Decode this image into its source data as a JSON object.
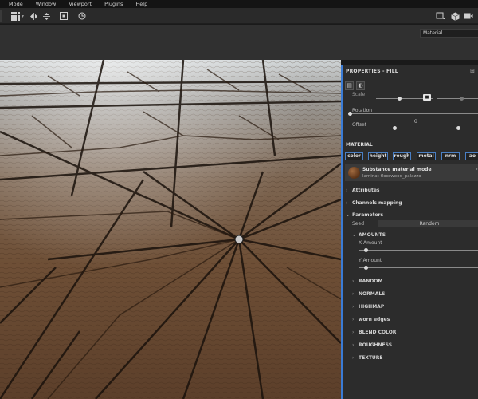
{
  "menu": [
    "Mode",
    "Window",
    "Viewport",
    "Plugins",
    "Help"
  ],
  "toolbar_icons": [
    "grid-icon",
    "flip-horizontal-icon",
    "flip-vertical-icon",
    "frame-icon",
    "reset-icon",
    "screen-icon",
    "cube-icon",
    "camera-icon"
  ],
  "viewport_select": "Material",
  "panel": {
    "title": "PROPERTIES - FILL",
    "menu_glyph": "⊞",
    "scale_label": "Scale",
    "rotation_label": "Rotation",
    "offset_label": "Offset",
    "offset_value": "0",
    "material_section": "MATERIAL",
    "channels": [
      "color",
      "height",
      "rough",
      "metal",
      "nrm",
      "ao"
    ],
    "material_mode": "Substance material mode",
    "material_name": "laminat-floorwood_palazzo",
    "attributes": "Attributes",
    "channels_mapping": "Channels mapping",
    "parameters": "Parameters",
    "seed_label": "Seed",
    "seed_value": "Random",
    "amounts": "AMOUNTS",
    "x_amount": "X Amount",
    "y_amount": "Y Amount",
    "groups": [
      "RANDOM",
      "NORMALS",
      "HIGHMAP",
      "worn edges",
      "BLEND COLOR",
      "ROUGHNESS",
      "TEXTURE"
    ]
  }
}
